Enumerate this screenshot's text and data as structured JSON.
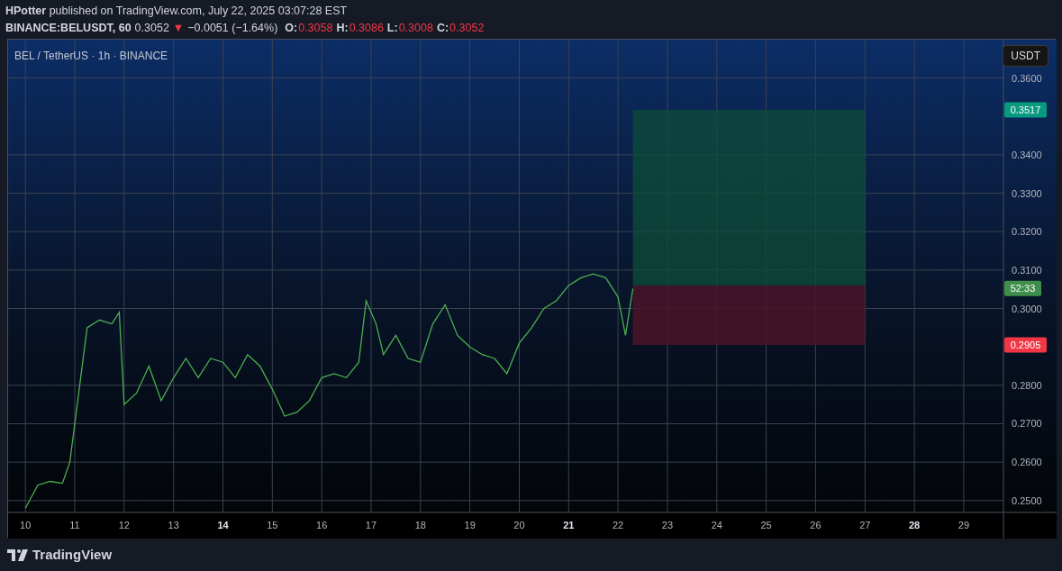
{
  "header": {
    "byline": "**HPotter** published on TradingView.com, July 22, 2025 03:07:28 EST",
    "symbol": "BINANCE:BELUSDT, 60",
    "last": "0.3052",
    "arrow": "▼",
    "change": "−0.0051 (−1.64%)",
    "ohlc": [
      {
        "label": "O:",
        "value": "0.3058"
      },
      {
        "label": "H:",
        "value": "0.3086"
      },
      {
        "label": "L:",
        "value": "0.3008"
      },
      {
        "label": "C:",
        "value": "0.3052"
      }
    ]
  },
  "chart": {
    "legend": "BEL / TetherUS · 1h · BINANCE",
    "currency_button": "USDT",
    "chart_data": {
      "type": "line",
      "x": [
        10.0,
        10.25,
        10.5,
        10.75,
        10.9,
        11.0,
        11.1,
        11.25,
        11.5,
        11.75,
        11.9,
        12.0,
        12.25,
        12.5,
        12.75,
        13.0,
        13.25,
        13.5,
        13.75,
        14.0,
        14.25,
        14.5,
        14.75,
        15.0,
        15.25,
        15.5,
        15.75,
        16.0,
        16.25,
        16.5,
        16.75,
        16.9,
        17.1,
        17.25,
        17.5,
        17.75,
        18.0,
        18.25,
        18.5,
        18.75,
        19.0,
        19.25,
        19.5,
        19.75,
        20.0,
        20.25,
        20.5,
        20.75,
        21.0,
        21.25,
        21.5,
        21.75,
        22.0,
        22.15,
        22.3
      ],
      "series": [
        {
          "color": "#4caf50",
          "values": [
            0.248,
            0.254,
            0.255,
            0.2545,
            0.26,
            0.27,
            0.28,
            0.295,
            0.297,
            0.296,
            0.299,
            0.275,
            0.278,
            0.285,
            0.276,
            0.282,
            0.287,
            0.282,
            0.287,
            0.286,
            0.282,
            0.288,
            0.285,
            0.279,
            0.272,
            0.273,
            0.276,
            0.282,
            0.283,
            0.282,
            0.286,
            0.302,
            0.296,
            0.288,
            0.293,
            0.287,
            0.286,
            0.296,
            0.301,
            0.293,
            0.29,
            0.288,
            0.287,
            0.283,
            0.291,
            0.295,
            0.3,
            0.302,
            0.306,
            0.308,
            0.309,
            0.308,
            0.303,
            0.293,
            0.3052
          ]
        }
      ],
      "grid": true,
      "xlim": [
        9.65,
        30.88
      ],
      "ylim": [
        0.2469,
        0.37
      ],
      "xticks": [
        {
          "value": 10,
          "label": "10"
        },
        {
          "value": 11,
          "label": "11"
        },
        {
          "value": 12,
          "label": "12"
        },
        {
          "value": 13,
          "label": "13"
        },
        {
          "value": 14,
          "label": "14"
        },
        {
          "value": 15,
          "label": "15"
        },
        {
          "value": 16,
          "label": "16"
        },
        {
          "value": 17,
          "label": "17"
        },
        {
          "value": 18,
          "label": "18"
        },
        {
          "value": 19,
          "label": "19"
        },
        {
          "value": 20,
          "label": "20"
        },
        {
          "value": 21,
          "label": "21"
        },
        {
          "value": 22,
          "label": "22"
        },
        {
          "value": 23,
          "label": "23"
        },
        {
          "value": 24,
          "label": "24"
        },
        {
          "value": 25,
          "label": "25"
        },
        {
          "value": 26,
          "label": "26"
        },
        {
          "value": 27,
          "label": "27"
        },
        {
          "value": 28,
          "label": "28"
        },
        {
          "value": 29,
          "label": "29"
        }
      ],
      "yticks": [
        {
          "value": 0.25,
          "label": "0.2500"
        },
        {
          "value": 0.26,
          "label": "0.2600"
        },
        {
          "value": 0.27,
          "label": "0.2700"
        },
        {
          "value": 0.28,
          "label": "0.2800"
        },
        {
          "value": 0.3,
          "label": "0.3000"
        },
        {
          "value": 0.31,
          "label": "0.3100"
        },
        {
          "value": 0.32,
          "label": "0.3200"
        },
        {
          "value": 0.33,
          "label": "0.3300"
        },
        {
          "value": 0.34,
          "label": "0.3400"
        },
        {
          "value": 0.36,
          "label": "0.3600"
        }
      ]
    },
    "time_axis": [
      {
        "bold": false
      },
      {
        "bold": false
      },
      {
        "bold": false
      },
      {
        "bold": false
      },
      {
        "bold": true
      },
      {
        "bold": false
      },
      {
        "bold": false
      },
      {
        "bold": false
      },
      {
        "bold": false
      },
      {
        "bold": false
      },
      {
        "bold": false
      },
      {
        "bold": true
      },
      {
        "bold": false
      },
      {
        "bold": false
      },
      {
        "bold": false
      },
      {
        "bold": false
      },
      {
        "bold": false
      },
      {
        "bold": false
      },
      {
        "bold": true
      },
      {
        "bold": false
      }
    ],
    "price_tags": [
      {
        "kind": "target",
        "text": "0.3517",
        "color": "#089981"
      },
      {
        "kind": "countdown",
        "text": "52:33",
        "color": "#3f8f4a"
      },
      {
        "kind": "stop",
        "text": "0.2905",
        "color": "#f23645"
      }
    ]
  },
  "footer": {
    "logo_text": "TradingView"
  }
}
